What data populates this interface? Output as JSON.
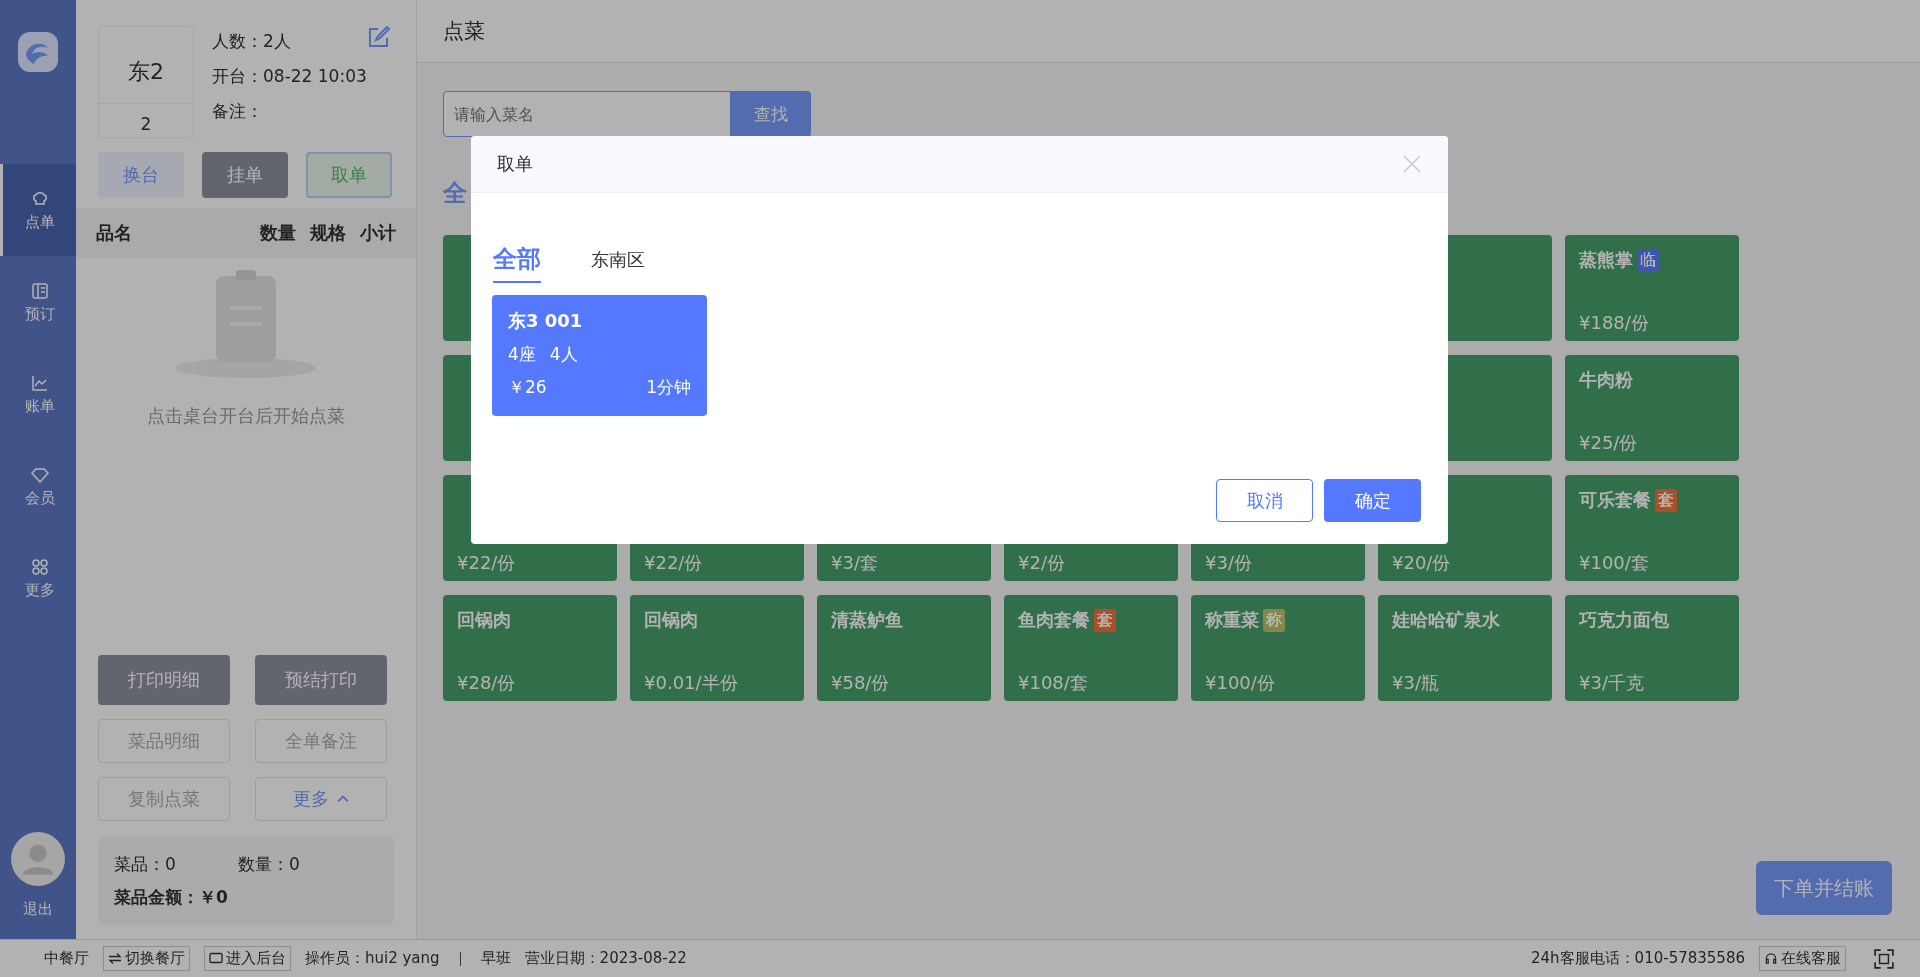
{
  "sidebar": {
    "items": [
      {
        "label": "点单",
        "selected": true
      },
      {
        "label": "预订",
        "selected": false
      },
      {
        "label": "账单",
        "selected": false
      },
      {
        "label": "会员",
        "selected": false
      },
      {
        "label": "更多",
        "selected": false
      }
    ],
    "logout": "退出"
  },
  "table_info": {
    "name": "东2",
    "number": "2",
    "guests": "人数：2人",
    "opened": "开台：08-22 10:03",
    "note": "备注："
  },
  "table_actions": [
    {
      "label": "换台",
      "kind": "light"
    },
    {
      "label": "挂单",
      "kind": "grey"
    },
    {
      "label": "取单",
      "kind": "green"
    }
  ],
  "order_columns": [
    "品名",
    "数量",
    "规格",
    "小计"
  ],
  "empty_text": "点击桌台开台后开始点菜",
  "order_actions": [
    {
      "label": "打印明细",
      "kind": "filled"
    },
    {
      "label": "预结打印",
      "kind": "filled"
    },
    {
      "label": "菜品明细",
      "kind": "outline"
    },
    {
      "label": "全单备注",
      "kind": "outline"
    },
    {
      "label": "复制点菜",
      "kind": "outline"
    },
    {
      "label": "更多",
      "kind": "more"
    }
  ],
  "summary": {
    "dishes": "菜品：0",
    "quantity": "数量：0",
    "amount_label": "菜品金额：",
    "amount": "￥0"
  },
  "main": {
    "title": "点菜",
    "search_placeholder": "请输入菜名",
    "search_button": "查找",
    "category": "全",
    "dish_rows": [
      [
        {
          "name": "蒸熊掌",
          "tag": "临",
          "color": "#4057af",
          "price": "¥188/份"
        }
      ],
      [
        {
          "name": "牛肉粉",
          "price": "¥25/份"
        }
      ],
      [
        {
          "price": "¥22/份"
        },
        {
          "price": "¥22/份"
        },
        {
          "price": "¥3/套"
        },
        {
          "price": "¥2/份"
        },
        {
          "price": "¥3/份"
        },
        {
          "price": "¥20/份"
        },
        {
          "name": "可乐套餐",
          "tag": "套",
          "color": "#ac4f2a",
          "price": "¥100/套"
        }
      ],
      [
        {
          "name": "回锅肉",
          "price": "¥28/份"
        },
        {
          "name": "回锅肉",
          "price": "¥0.01/半份"
        },
        {
          "name": "清蒸鲈鱼",
          "price": "¥58/份"
        },
        {
          "name": "鱼肉套餐",
          "tag": "套",
          "color": "#ac4f2a",
          "price": "¥108/套"
        },
        {
          "name": "称重菜",
          "tag": "称",
          "color": "#82894a",
          "price": "¥100/份"
        },
        {
          "name": "娃哈哈矿泉水",
          "price": "¥3/瓶"
        },
        {
          "name": "巧克力面包",
          "price": "¥3/千克"
        }
      ]
    ],
    "checkout": "下单并结账"
  },
  "status_bar": {
    "restaurant": "中餐厅",
    "switch": "切换餐厅",
    "backend": "进入后台",
    "operator": "操作员：hui2 yang",
    "shift": "早班",
    "date": "营业日期：2023-08-22",
    "hotline": "24h客服电话：010-57835586",
    "service": "在线客服"
  },
  "dialog": {
    "title": "取单",
    "tabs": [
      {
        "label": "全部",
        "selected": true
      },
      {
        "label": "东南区",
        "selected": false
      }
    ],
    "orders": [
      {
        "table": "东3 001",
        "seats": "4座",
        "guests": "4人",
        "amount": "￥26",
        "time": "1分钟"
      }
    ],
    "cancel": "取消",
    "confirm": "确定"
  }
}
